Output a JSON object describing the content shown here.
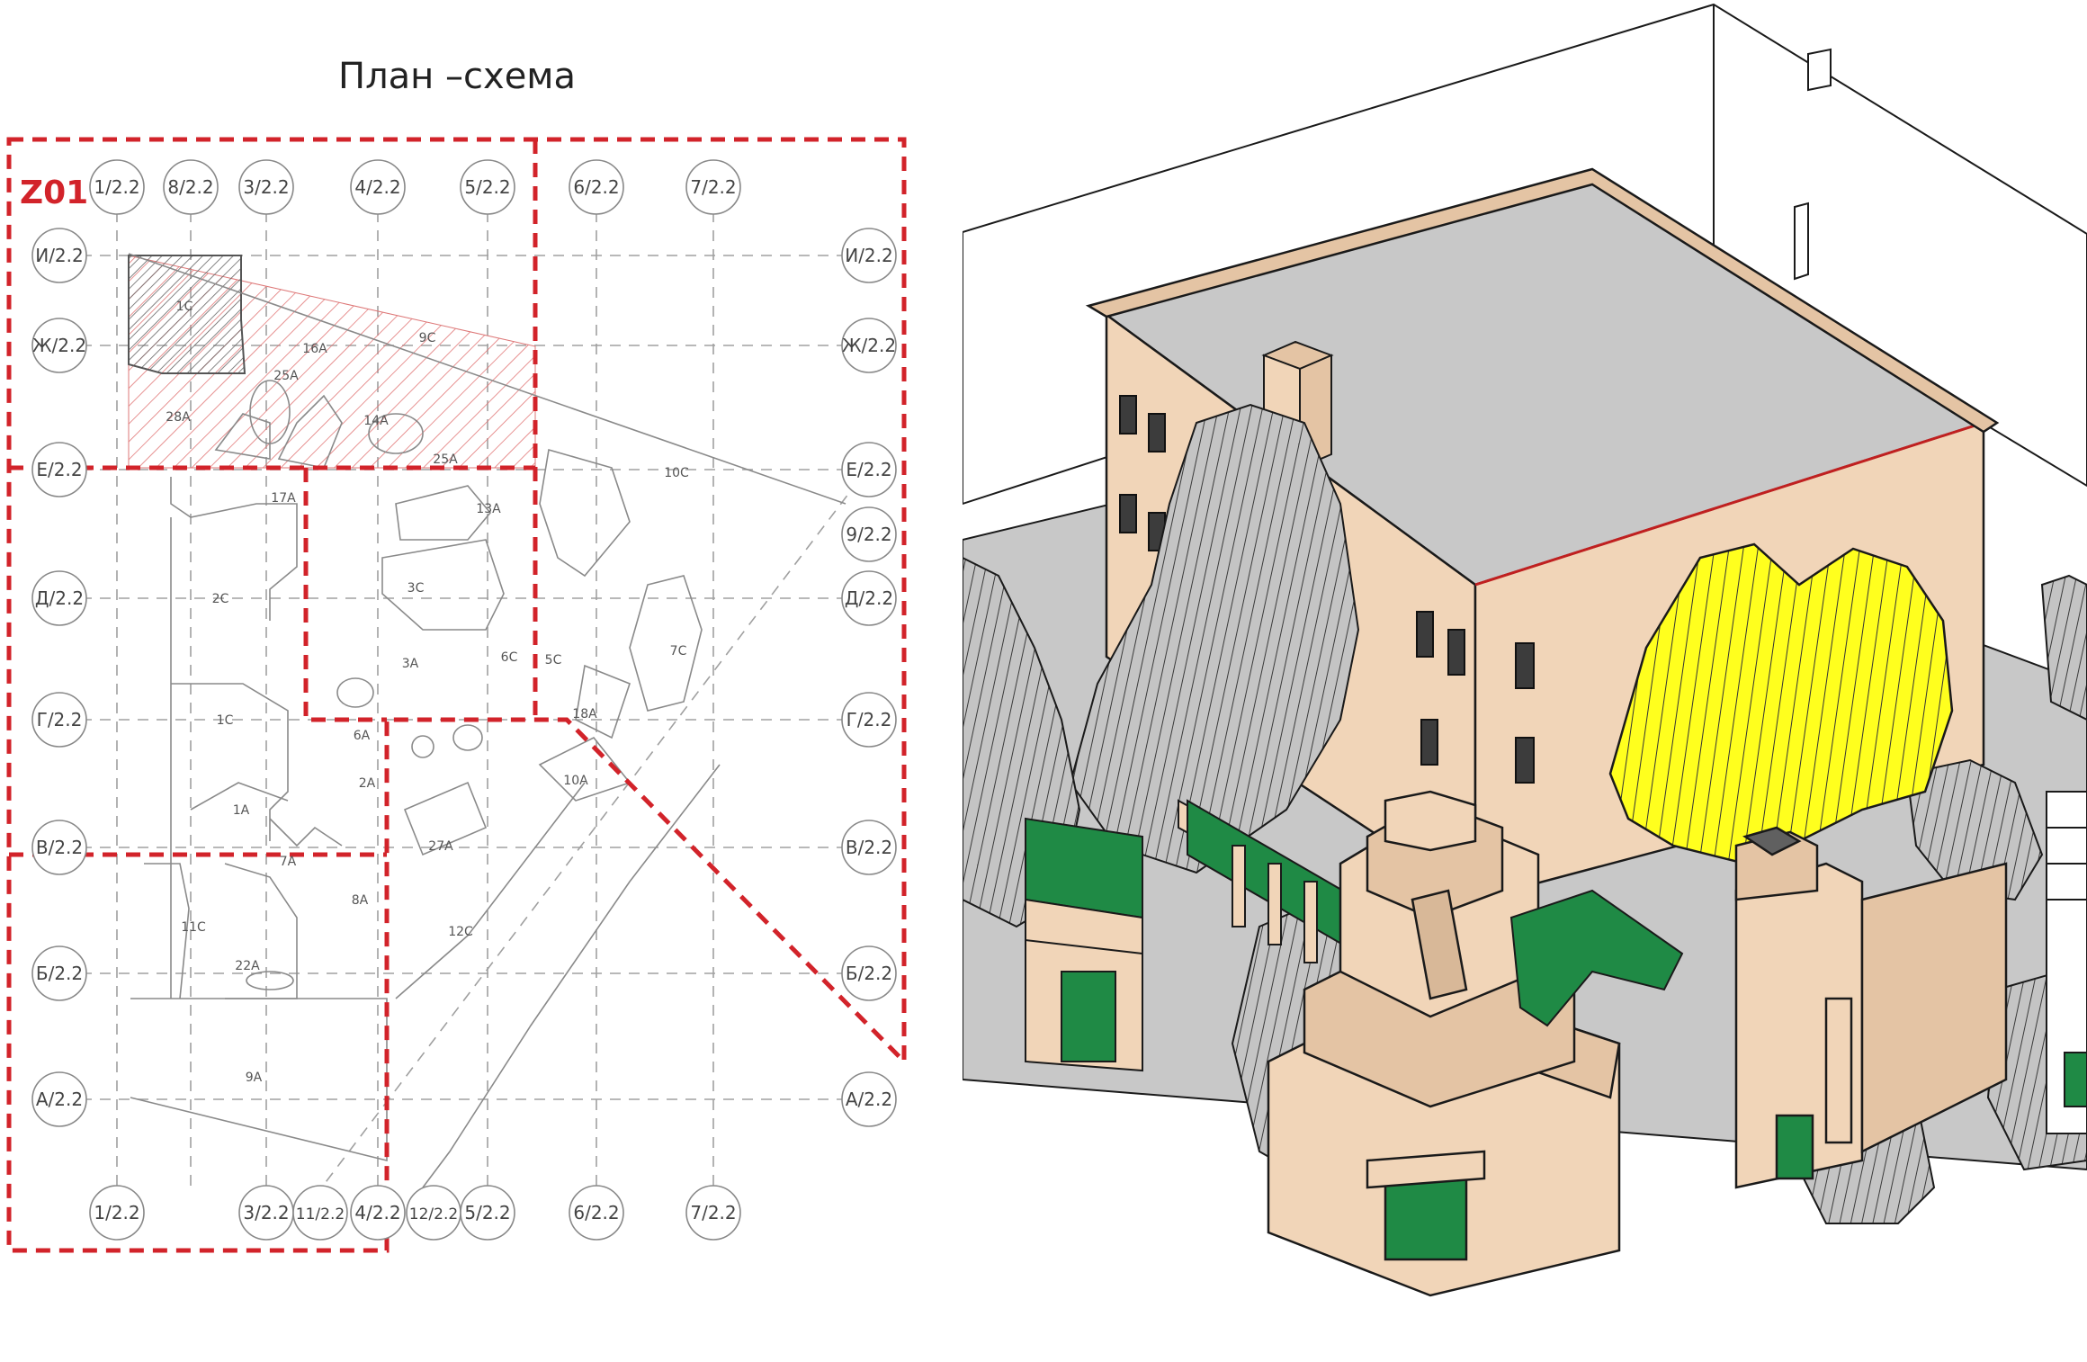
{
  "plan": {
    "title": "План –схема",
    "zone_label": "Z01",
    "axes_top": [
      "1/2.2",
      "8/2.2",
      "3/2.2",
      "4/2.2",
      "5/2.2",
      "6/2.2",
      "7/2.2"
    ],
    "axes_bottom": [
      "1/2.2",
      "3/2.2",
      "11/2.2",
      "4/2.2",
      "12/2.2",
      "5/2.2",
      "6/2.2",
      "7/2.2"
    ],
    "axes_left": [
      "И/2.2",
      "Ж/2.2",
      "Е/2.2",
      "Д/2.2",
      "Г/2.2",
      "В/2.2",
      "Б/2.2",
      "А/2.2"
    ],
    "axes_right": [
      "И/2.2",
      "Ж/2.2",
      "Е/2.2",
      "9/2.2",
      "Д/2.2",
      "Г/2.2",
      "В/2.2",
      "Б/2.2",
      "А/2.2"
    ],
    "room_labels": [
      "1С",
      "9С",
      "16А",
      "25А",
      "28А",
      "14А",
      "25А",
      "17А",
      "13А",
      "3С",
      "2С",
      "10С",
      "3А",
      "6С",
      "5С",
      "7С",
      "1С",
      "18А",
      "6А",
      "2А",
      "1А",
      "7А",
      "8А",
      "27А",
      "10А",
      "11С",
      "22А",
      "12С",
      "9А"
    ],
    "colors": {
      "boundary": "#d2232a",
      "grid": "#9a9a9a",
      "outline": "#8a8a8a",
      "hatch_red": "#e07070",
      "hatch_gray": "#777777"
    }
  },
  "model": {
    "colors": {
      "facade": "#f1d5b8",
      "roof": "#c8c8c8",
      "highlight_rock": "#ffff1e",
      "rock": "#a8a8a8",
      "floor": "#1f8a45",
      "edge": "#1a1a1a"
    }
  }
}
